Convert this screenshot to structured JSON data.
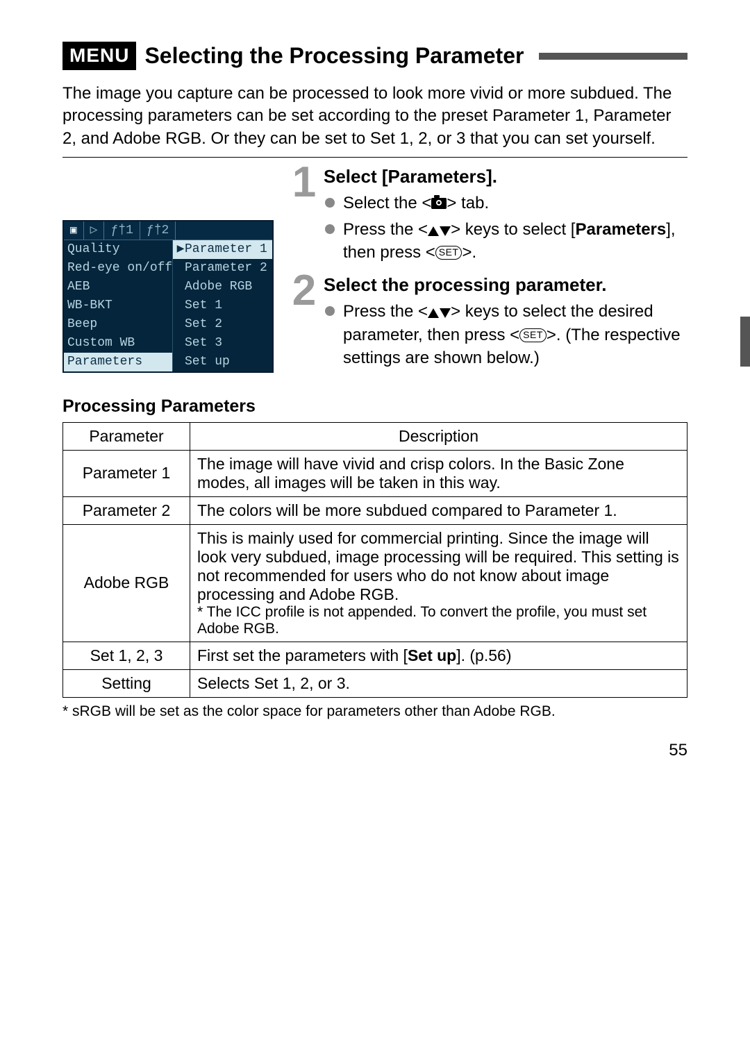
{
  "header": {
    "badge": "MENU",
    "title": "Selecting the Processing Parameter"
  },
  "intro": "The image you capture can be processed to look more vivid or more subdued. The processing parameters can be set according to the preset Parameter 1, Parameter 2, and Adobe RGB. Or they can be set to Set 1, 2, or 3 that you can set yourself.",
  "lcd": {
    "tabs": [
      "camera",
      "play",
      "tool1",
      "tool2"
    ],
    "menu_items": [
      "Quality",
      "Red-eye on/off",
      "AEB",
      "WB-BKT",
      "Beep",
      "Custom WB",
      "Parameters"
    ],
    "selected_menu_index": 6,
    "options": [
      "Parameter 1",
      "Parameter 2",
      "Adobe RGB",
      "Set 1",
      "Set 2",
      "Set 3",
      "Set up"
    ],
    "selected_option_index": 0
  },
  "steps": [
    {
      "num": "1",
      "title": "Select [Parameters].",
      "bullets": [
        {
          "pre": "Select the <",
          "icon": "camera",
          "post": "> tab."
        },
        {
          "pre": "Press the <",
          "icon": "updown",
          "post": "> keys to select [",
          "bold": "Parameters",
          "tail": "], then press <",
          "icon2": "set",
          "tail2": ">."
        }
      ]
    },
    {
      "num": "2",
      "title": "Select the processing parameter.",
      "bullets": [
        {
          "pre": "Press the <",
          "icon": "updown",
          "post": "> keys to select the desired parameter, then press <",
          "icon2": "set",
          "tail2": ">. (The respective settings are shown below.)"
        }
      ]
    }
  ],
  "table_section_title": "Processing Parameters",
  "table_headers": [
    "Parameter",
    "Description"
  ],
  "table_rows": [
    {
      "name": "Parameter 1",
      "desc": "The image will have vivid and crisp colors. In the Basic Zone modes, all images will be taken in this way."
    },
    {
      "name": "Parameter 2",
      "desc": "The colors will be more subdued compared to Parameter 1."
    },
    {
      "name": "Adobe RGB",
      "desc": "This is mainly used for commercial printing. Since the image will look very subdued, image processing will be required. This setting is not recommended for users who do not know about image processing and Adobe RGB.",
      "fine": "* The ICC profile is not appended. To convert the profile, you must set Adobe RGB."
    },
    {
      "name": "Set 1, 2, 3",
      "desc_pre": "First set the parameters with [",
      "desc_bold": "Set up",
      "desc_post": "]. (p.56)"
    },
    {
      "name": "Setting",
      "desc": "Selects Set 1, 2, or 3."
    }
  ],
  "footnote": "* sRGB will be set as the color space for parameters other than Adobe RGB.",
  "page_number": "55"
}
